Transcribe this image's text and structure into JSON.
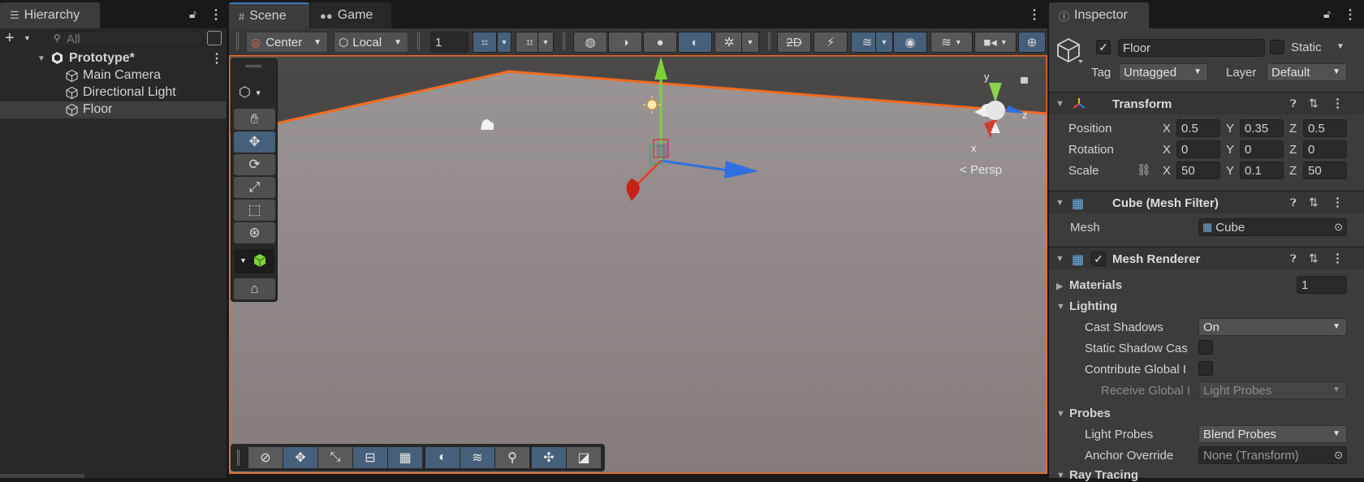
{
  "hierarchy": {
    "tab_label": "Hierarchy",
    "search_placeholder": "All",
    "scene_name": "Prototype*",
    "items": [
      {
        "label": "Main Camera"
      },
      {
        "label": "Directional Light"
      },
      {
        "label": "Floor"
      }
    ]
  },
  "scene_view": {
    "tabs": [
      {
        "label": "Scene"
      },
      {
        "label": "Game"
      }
    ],
    "toolbar": {
      "pivot": "Center",
      "space": "Local",
      "grid_value": "1"
    },
    "gizmo_labels": {
      "y": "y",
      "z": "z",
      "x": "x",
      "persp": "Persp"
    }
  },
  "inspector": {
    "tab_label": "Inspector",
    "object_name": "Floor",
    "static_label": "Static",
    "tag_label": "Tag",
    "tag_value": "Untagged",
    "layer_label": "Layer",
    "layer_value": "Default",
    "transform": {
      "title": "Transform",
      "position_label": "Position",
      "rotation_label": "Rotation",
      "scale_label": "Scale",
      "axis_x": "X",
      "axis_y": "Y",
      "axis_z": "Z",
      "position": {
        "x": "0.5",
        "y": "0.35",
        "z": "0.5"
      },
      "rotation": {
        "x": "0",
        "y": "0",
        "z": "0"
      },
      "scale": {
        "x": "50",
        "y": "0.1",
        "z": "50"
      }
    },
    "mesh_filter": {
      "title": "Cube (Mesh Filter)",
      "mesh_label": "Mesh",
      "mesh_value": "Cube"
    },
    "mesh_renderer": {
      "title": "Mesh Renderer",
      "materials_label": "Materials",
      "materials_count": "1",
      "lighting_label": "Lighting",
      "cast_shadows_label": "Cast Shadows",
      "cast_shadows_value": "On",
      "static_shadow_label": "Static Shadow Cas",
      "contribute_gi_label": "Contribute Global I",
      "receive_gi_label": "Receive Global I",
      "receive_gi_value": "Light Probes",
      "probes_label": "Probes",
      "light_probes_label": "Light Probes",
      "light_probes_value": "Blend Probes",
      "anchor_override_label": "Anchor Override",
      "anchor_override_value": "None (Transform)",
      "ray_tracing_label": "Ray Tracing"
    }
  },
  "colors": {
    "selection_orange": "#f26b21",
    "selected_blue": "#46607c",
    "panel": "#282828"
  }
}
